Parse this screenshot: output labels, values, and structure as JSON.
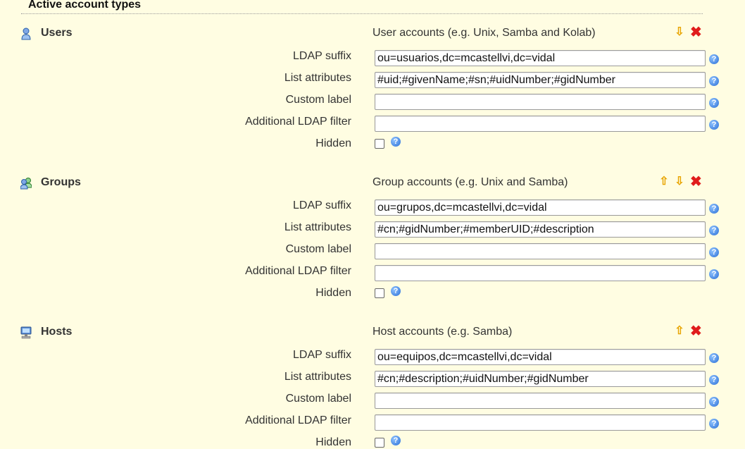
{
  "section": {
    "title": "Active account types"
  },
  "labels": {
    "ldap_suffix": "LDAP suffix",
    "list_attributes": "List attributes",
    "custom_label": "Custom label",
    "additional_filter": "Additional LDAP filter",
    "hidden": "Hidden"
  },
  "types": [
    {
      "name": "Users",
      "description": "User accounts (e.g. Unix, Samba and Kolab)",
      "icon": "user-icon",
      "ldap_suffix": "ou=usuarios,dc=mcastellvi,dc=vidal",
      "list_attributes": "#uid;#givenName;#sn;#uidNumber;#gidNumber",
      "custom_label": "",
      "additional_filter": "",
      "hidden": false,
      "can_move_up": false,
      "can_move_down": true
    },
    {
      "name": "Groups",
      "description": "Group accounts (e.g. Unix and Samba)",
      "icon": "group-icon",
      "ldap_suffix": "ou=grupos,dc=mcastellvi,dc=vidal",
      "list_attributes": "#cn;#gidNumber;#memberUID;#description",
      "custom_label": "",
      "additional_filter": "",
      "hidden": false,
      "can_move_up": true,
      "can_move_down": true
    },
    {
      "name": "Hosts",
      "description": "Host accounts (e.g. Samba)",
      "icon": "host-icon",
      "ldap_suffix": "ou=equipos,dc=mcastellvi,dc=vidal",
      "list_attributes": "#cn;#description;#uidNumber;#gidNumber",
      "custom_label": "",
      "additional_filter": "",
      "hidden": false,
      "can_move_up": true,
      "can_move_down": false
    }
  ],
  "colors": {
    "background": "#fffde2",
    "move_arrow": "#e8a400",
    "delete": "#e01c1c",
    "help": "#2b6fd6"
  }
}
